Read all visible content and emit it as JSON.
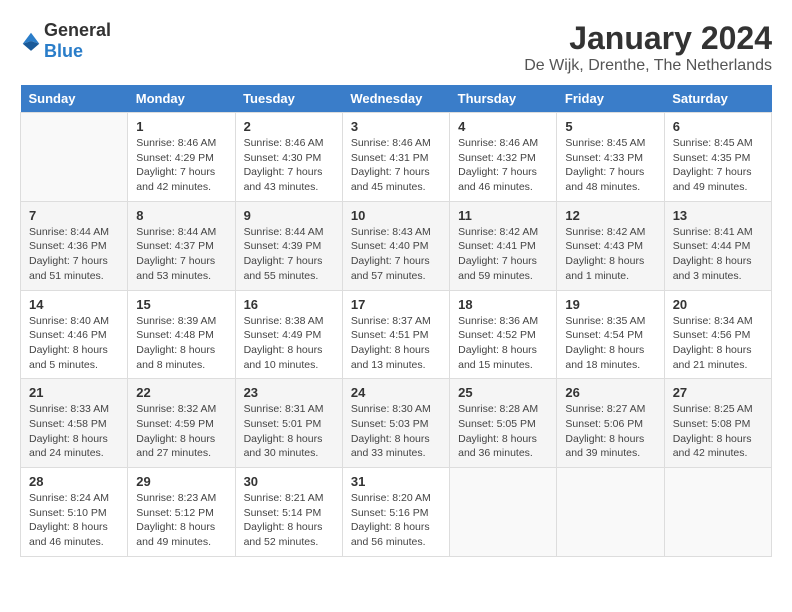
{
  "header": {
    "logo_general": "General",
    "logo_blue": "Blue",
    "title": "January 2024",
    "subtitle": "De Wijk, Drenthe, The Netherlands"
  },
  "calendar": {
    "days_of_week": [
      "Sunday",
      "Monday",
      "Tuesday",
      "Wednesday",
      "Thursday",
      "Friday",
      "Saturday"
    ],
    "weeks": [
      [
        {
          "day": "",
          "info": ""
        },
        {
          "day": "1",
          "info": "Sunrise: 8:46 AM\nSunset: 4:29 PM\nDaylight: 7 hours\nand 42 minutes."
        },
        {
          "day": "2",
          "info": "Sunrise: 8:46 AM\nSunset: 4:30 PM\nDaylight: 7 hours\nand 43 minutes."
        },
        {
          "day": "3",
          "info": "Sunrise: 8:46 AM\nSunset: 4:31 PM\nDaylight: 7 hours\nand 45 minutes."
        },
        {
          "day": "4",
          "info": "Sunrise: 8:46 AM\nSunset: 4:32 PM\nDaylight: 7 hours\nand 46 minutes."
        },
        {
          "day": "5",
          "info": "Sunrise: 8:45 AM\nSunset: 4:33 PM\nDaylight: 7 hours\nand 48 minutes."
        },
        {
          "day": "6",
          "info": "Sunrise: 8:45 AM\nSunset: 4:35 PM\nDaylight: 7 hours\nand 49 minutes."
        }
      ],
      [
        {
          "day": "7",
          "info": "Sunrise: 8:44 AM\nSunset: 4:36 PM\nDaylight: 7 hours\nand 51 minutes."
        },
        {
          "day": "8",
          "info": "Sunrise: 8:44 AM\nSunset: 4:37 PM\nDaylight: 7 hours\nand 53 minutes."
        },
        {
          "day": "9",
          "info": "Sunrise: 8:44 AM\nSunset: 4:39 PM\nDaylight: 7 hours\nand 55 minutes."
        },
        {
          "day": "10",
          "info": "Sunrise: 8:43 AM\nSunset: 4:40 PM\nDaylight: 7 hours\nand 57 minutes."
        },
        {
          "day": "11",
          "info": "Sunrise: 8:42 AM\nSunset: 4:41 PM\nDaylight: 7 hours\nand 59 minutes."
        },
        {
          "day": "12",
          "info": "Sunrise: 8:42 AM\nSunset: 4:43 PM\nDaylight: 8 hours\nand 1 minute."
        },
        {
          "day": "13",
          "info": "Sunrise: 8:41 AM\nSunset: 4:44 PM\nDaylight: 8 hours\nand 3 minutes."
        }
      ],
      [
        {
          "day": "14",
          "info": "Sunrise: 8:40 AM\nSunset: 4:46 PM\nDaylight: 8 hours\nand 5 minutes."
        },
        {
          "day": "15",
          "info": "Sunrise: 8:39 AM\nSunset: 4:48 PM\nDaylight: 8 hours\nand 8 minutes."
        },
        {
          "day": "16",
          "info": "Sunrise: 8:38 AM\nSunset: 4:49 PM\nDaylight: 8 hours\nand 10 minutes."
        },
        {
          "day": "17",
          "info": "Sunrise: 8:37 AM\nSunset: 4:51 PM\nDaylight: 8 hours\nand 13 minutes."
        },
        {
          "day": "18",
          "info": "Sunrise: 8:36 AM\nSunset: 4:52 PM\nDaylight: 8 hours\nand 15 minutes."
        },
        {
          "day": "19",
          "info": "Sunrise: 8:35 AM\nSunset: 4:54 PM\nDaylight: 8 hours\nand 18 minutes."
        },
        {
          "day": "20",
          "info": "Sunrise: 8:34 AM\nSunset: 4:56 PM\nDaylight: 8 hours\nand 21 minutes."
        }
      ],
      [
        {
          "day": "21",
          "info": "Sunrise: 8:33 AM\nSunset: 4:58 PM\nDaylight: 8 hours\nand 24 minutes."
        },
        {
          "day": "22",
          "info": "Sunrise: 8:32 AM\nSunset: 4:59 PM\nDaylight: 8 hours\nand 27 minutes."
        },
        {
          "day": "23",
          "info": "Sunrise: 8:31 AM\nSunset: 5:01 PM\nDaylight: 8 hours\nand 30 minutes."
        },
        {
          "day": "24",
          "info": "Sunrise: 8:30 AM\nSunset: 5:03 PM\nDaylight: 8 hours\nand 33 minutes."
        },
        {
          "day": "25",
          "info": "Sunrise: 8:28 AM\nSunset: 5:05 PM\nDaylight: 8 hours\nand 36 minutes."
        },
        {
          "day": "26",
          "info": "Sunrise: 8:27 AM\nSunset: 5:06 PM\nDaylight: 8 hours\nand 39 minutes."
        },
        {
          "day": "27",
          "info": "Sunrise: 8:25 AM\nSunset: 5:08 PM\nDaylight: 8 hours\nand 42 minutes."
        }
      ],
      [
        {
          "day": "28",
          "info": "Sunrise: 8:24 AM\nSunset: 5:10 PM\nDaylight: 8 hours\nand 46 minutes."
        },
        {
          "day": "29",
          "info": "Sunrise: 8:23 AM\nSunset: 5:12 PM\nDaylight: 8 hours\nand 49 minutes."
        },
        {
          "day": "30",
          "info": "Sunrise: 8:21 AM\nSunset: 5:14 PM\nDaylight: 8 hours\nand 52 minutes."
        },
        {
          "day": "31",
          "info": "Sunrise: 8:20 AM\nSunset: 5:16 PM\nDaylight: 8 hours\nand 56 minutes."
        },
        {
          "day": "",
          "info": ""
        },
        {
          "day": "",
          "info": ""
        },
        {
          "day": "",
          "info": ""
        }
      ]
    ]
  }
}
